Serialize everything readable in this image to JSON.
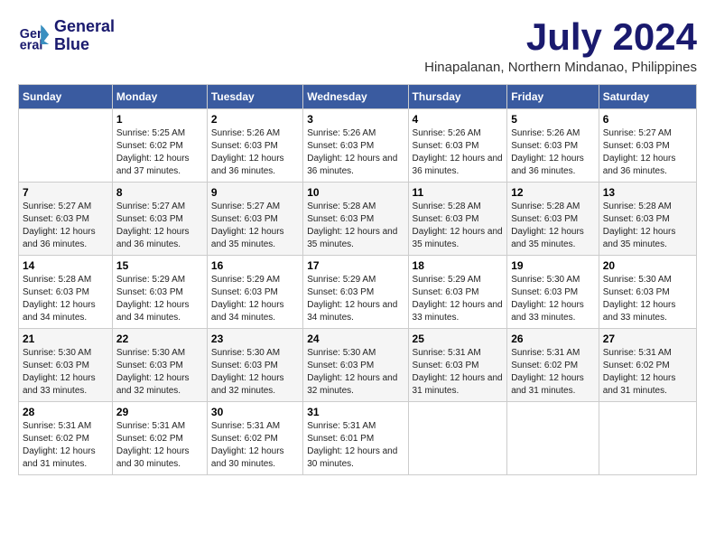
{
  "logo": {
    "line1": "General",
    "line2": "Blue"
  },
  "title": "July 2024",
  "subtitle": "Hinapalanan, Northern Mindanao, Philippines",
  "days_header": [
    "Sunday",
    "Monday",
    "Tuesday",
    "Wednesday",
    "Thursday",
    "Friday",
    "Saturday"
  ],
  "weeks": [
    [
      {
        "day": "",
        "sunrise": "",
        "sunset": "",
        "daylight": ""
      },
      {
        "day": "1",
        "sunrise": "Sunrise: 5:25 AM",
        "sunset": "Sunset: 6:02 PM",
        "daylight": "Daylight: 12 hours and 37 minutes."
      },
      {
        "day": "2",
        "sunrise": "Sunrise: 5:26 AM",
        "sunset": "Sunset: 6:03 PM",
        "daylight": "Daylight: 12 hours and 36 minutes."
      },
      {
        "day": "3",
        "sunrise": "Sunrise: 5:26 AM",
        "sunset": "Sunset: 6:03 PM",
        "daylight": "Daylight: 12 hours and 36 minutes."
      },
      {
        "day": "4",
        "sunrise": "Sunrise: 5:26 AM",
        "sunset": "Sunset: 6:03 PM",
        "daylight": "Daylight: 12 hours and 36 minutes."
      },
      {
        "day": "5",
        "sunrise": "Sunrise: 5:26 AM",
        "sunset": "Sunset: 6:03 PM",
        "daylight": "Daylight: 12 hours and 36 minutes."
      },
      {
        "day": "6",
        "sunrise": "Sunrise: 5:27 AM",
        "sunset": "Sunset: 6:03 PM",
        "daylight": "Daylight: 12 hours and 36 minutes."
      }
    ],
    [
      {
        "day": "7",
        "sunrise": "Sunrise: 5:27 AM",
        "sunset": "Sunset: 6:03 PM",
        "daylight": "Daylight: 12 hours and 36 minutes."
      },
      {
        "day": "8",
        "sunrise": "Sunrise: 5:27 AM",
        "sunset": "Sunset: 6:03 PM",
        "daylight": "Daylight: 12 hours and 36 minutes."
      },
      {
        "day": "9",
        "sunrise": "Sunrise: 5:27 AM",
        "sunset": "Sunset: 6:03 PM",
        "daylight": "Daylight: 12 hours and 35 minutes."
      },
      {
        "day": "10",
        "sunrise": "Sunrise: 5:28 AM",
        "sunset": "Sunset: 6:03 PM",
        "daylight": "Daylight: 12 hours and 35 minutes."
      },
      {
        "day": "11",
        "sunrise": "Sunrise: 5:28 AM",
        "sunset": "Sunset: 6:03 PM",
        "daylight": "Daylight: 12 hours and 35 minutes."
      },
      {
        "day": "12",
        "sunrise": "Sunrise: 5:28 AM",
        "sunset": "Sunset: 6:03 PM",
        "daylight": "Daylight: 12 hours and 35 minutes."
      },
      {
        "day": "13",
        "sunrise": "Sunrise: 5:28 AM",
        "sunset": "Sunset: 6:03 PM",
        "daylight": "Daylight: 12 hours and 35 minutes."
      }
    ],
    [
      {
        "day": "14",
        "sunrise": "Sunrise: 5:28 AM",
        "sunset": "Sunset: 6:03 PM",
        "daylight": "Daylight: 12 hours and 34 minutes."
      },
      {
        "day": "15",
        "sunrise": "Sunrise: 5:29 AM",
        "sunset": "Sunset: 6:03 PM",
        "daylight": "Daylight: 12 hours and 34 minutes."
      },
      {
        "day": "16",
        "sunrise": "Sunrise: 5:29 AM",
        "sunset": "Sunset: 6:03 PM",
        "daylight": "Daylight: 12 hours and 34 minutes."
      },
      {
        "day": "17",
        "sunrise": "Sunrise: 5:29 AM",
        "sunset": "Sunset: 6:03 PM",
        "daylight": "Daylight: 12 hours and 34 minutes."
      },
      {
        "day": "18",
        "sunrise": "Sunrise: 5:29 AM",
        "sunset": "Sunset: 6:03 PM",
        "daylight": "Daylight: 12 hours and 33 minutes."
      },
      {
        "day": "19",
        "sunrise": "Sunrise: 5:30 AM",
        "sunset": "Sunset: 6:03 PM",
        "daylight": "Daylight: 12 hours and 33 minutes."
      },
      {
        "day": "20",
        "sunrise": "Sunrise: 5:30 AM",
        "sunset": "Sunset: 6:03 PM",
        "daylight": "Daylight: 12 hours and 33 minutes."
      }
    ],
    [
      {
        "day": "21",
        "sunrise": "Sunrise: 5:30 AM",
        "sunset": "Sunset: 6:03 PM",
        "daylight": "Daylight: 12 hours and 33 minutes."
      },
      {
        "day": "22",
        "sunrise": "Sunrise: 5:30 AM",
        "sunset": "Sunset: 6:03 PM",
        "daylight": "Daylight: 12 hours and 32 minutes."
      },
      {
        "day": "23",
        "sunrise": "Sunrise: 5:30 AM",
        "sunset": "Sunset: 6:03 PM",
        "daylight": "Daylight: 12 hours and 32 minutes."
      },
      {
        "day": "24",
        "sunrise": "Sunrise: 5:30 AM",
        "sunset": "Sunset: 6:03 PM",
        "daylight": "Daylight: 12 hours and 32 minutes."
      },
      {
        "day": "25",
        "sunrise": "Sunrise: 5:31 AM",
        "sunset": "Sunset: 6:03 PM",
        "daylight": "Daylight: 12 hours and 31 minutes."
      },
      {
        "day": "26",
        "sunrise": "Sunrise: 5:31 AM",
        "sunset": "Sunset: 6:02 PM",
        "daylight": "Daylight: 12 hours and 31 minutes."
      },
      {
        "day": "27",
        "sunrise": "Sunrise: 5:31 AM",
        "sunset": "Sunset: 6:02 PM",
        "daylight": "Daylight: 12 hours and 31 minutes."
      }
    ],
    [
      {
        "day": "28",
        "sunrise": "Sunrise: 5:31 AM",
        "sunset": "Sunset: 6:02 PM",
        "daylight": "Daylight: 12 hours and 31 minutes."
      },
      {
        "day": "29",
        "sunrise": "Sunrise: 5:31 AM",
        "sunset": "Sunset: 6:02 PM",
        "daylight": "Daylight: 12 hours and 30 minutes."
      },
      {
        "day": "30",
        "sunrise": "Sunrise: 5:31 AM",
        "sunset": "Sunset: 6:02 PM",
        "daylight": "Daylight: 12 hours and 30 minutes."
      },
      {
        "day": "31",
        "sunrise": "Sunrise: 5:31 AM",
        "sunset": "Sunset: 6:01 PM",
        "daylight": "Daylight: 12 hours and 30 minutes."
      },
      {
        "day": "",
        "sunrise": "",
        "sunset": "",
        "daylight": ""
      },
      {
        "day": "",
        "sunrise": "",
        "sunset": "",
        "daylight": ""
      },
      {
        "day": "",
        "sunrise": "",
        "sunset": "",
        "daylight": ""
      }
    ]
  ]
}
